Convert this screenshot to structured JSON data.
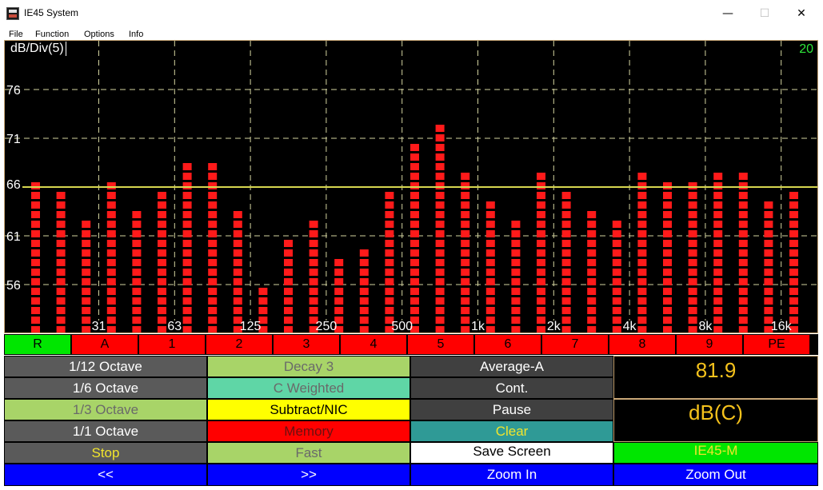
{
  "window": {
    "title": "IE45 System",
    "minimize_glyph": "—",
    "maximize_glyph": "☐",
    "close_glyph": "✕"
  },
  "menu": [
    "File",
    "Function",
    "Options",
    "Info"
  ],
  "graph": {
    "div_label": "dB/Div(5)",
    "range_value": "20",
    "reference_value": "66",
    "reference_level": 66,
    "y_axis": {
      "min": 51,
      "max": 81,
      "tick_values": [
        76,
        71,
        61,
        56
      ],
      "tick_labels": [
        "76",
        "71",
        "61",
        "56"
      ]
    },
    "x_labels": [
      "31",
      "63",
      "125",
      "250",
      "500",
      "1k",
      "2k",
      "4k",
      "8k",
      "16k"
    ],
    "bar_values": [
      67,
      66,
      63,
      67,
      64,
      66,
      69,
      69,
      64,
      56,
      61,
      63,
      59,
      60,
      66,
      71,
      73,
      68,
      65,
      63,
      68,
      66,
      64,
      63,
      68,
      67,
      67,
      68,
      68,
      65,
      66
    ],
    "colors": {
      "bar": "#ff1a1a",
      "grid": "#d4d4a0",
      "reference": "#d6d650",
      "background": "#000000"
    }
  },
  "channels": [
    {
      "label": "R",
      "active": true
    },
    {
      "label": "A",
      "active": false
    },
    {
      "label": "1",
      "active": false
    },
    {
      "label": "2",
      "active": false
    },
    {
      "label": "3",
      "active": false
    },
    {
      "label": "4",
      "active": false
    },
    {
      "label": "5",
      "active": false
    },
    {
      "label": "6",
      "active": false
    },
    {
      "label": "7",
      "active": false
    },
    {
      "label": "8",
      "active": false
    },
    {
      "label": "9",
      "active": false
    },
    {
      "label": "PE",
      "active": false
    }
  ],
  "controls": {
    "col1": [
      "1/12 Octave",
      "1/6 Octave",
      "1/3 Octave",
      "1/1 Octave",
      "Stop"
    ],
    "col2": [
      "Decay 3",
      "C Weighted",
      "Subtract/NIC",
      "Memory",
      "Fast"
    ],
    "col3": [
      "Average-A",
      "Cont.",
      "Pause",
      "Clear",
      "Save Screen"
    ],
    "readout_value": "81.9",
    "readout_unit": "dB(C)",
    "model_label": "IE45-M",
    "nav": [
      "<<",
      ">>",
      "Zoom In",
      "Zoom Out"
    ]
  }
}
